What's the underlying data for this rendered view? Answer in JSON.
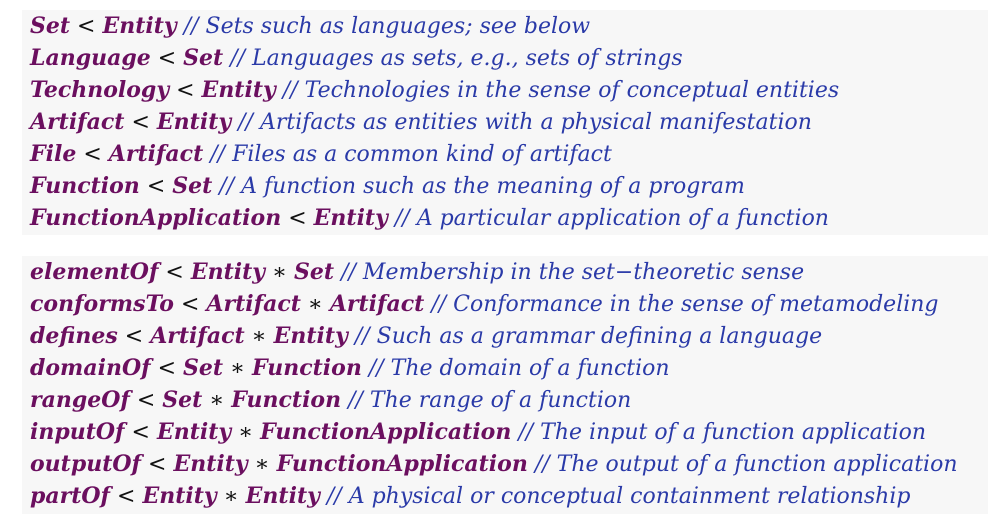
{
  "colors": {
    "keyword": "#6b0f5f",
    "comment": "#2a3aa8",
    "operator": "#111111",
    "background": "#f7f7f7"
  },
  "types": [
    {
      "name": "Set",
      "super": "Entity",
      "comment": "// Sets such as languages; see below"
    },
    {
      "name": "Language",
      "super": "Set",
      "comment": "// Languages as sets, e.g., sets of strings"
    },
    {
      "name": "Technology",
      "super": "Entity",
      "comment": "// Technologies in the sense of conceptual entities"
    },
    {
      "name": "Artifact",
      "super": "Entity",
      "comment": "// Artifacts as entities with a physical manifestation"
    },
    {
      "name": "File",
      "super": "Artifact",
      "comment": "// Files as a common kind of artifact"
    },
    {
      "name": "Function",
      "super": "Set",
      "comment": "// A function such as the meaning of a program"
    },
    {
      "name": "FunctionApplication",
      "super": "Entity",
      "comment": "// A particular application of a function"
    }
  ],
  "relations": [
    {
      "name": "elementOf",
      "domain": "Entity",
      "range": "Set",
      "comment": "// Membership in the set−theoretic sense"
    },
    {
      "name": "conformsTo",
      "domain": "Artifact",
      "range": "Artifact",
      "comment": "// Conformance in the sense of metamodeling"
    },
    {
      "name": "defines",
      "domain": "Artifact",
      "range": "Entity",
      "comment": "// Such as a grammar defining a language"
    },
    {
      "name": "domainOf",
      "domain": "Set",
      "range": "Function",
      "comment": "// The domain of a function"
    },
    {
      "name": "rangeOf",
      "domain": "Set",
      "range": "Function",
      "comment": "// The range of a function"
    },
    {
      "name": "inputOf",
      "domain": "Entity",
      "range": "FunctionApplication",
      "comment": "// The input of a function application"
    },
    {
      "name": "outputOf",
      "domain": "Entity",
      "range": "FunctionApplication",
      "comment": "// The output of a function application"
    },
    {
      "name": "partOf",
      "domain": "Entity",
      "range": "Entity",
      "comment": "// A physical or conceptual containment relationship"
    }
  ],
  "symbols": {
    "subtype": "<",
    "product": "∗"
  }
}
